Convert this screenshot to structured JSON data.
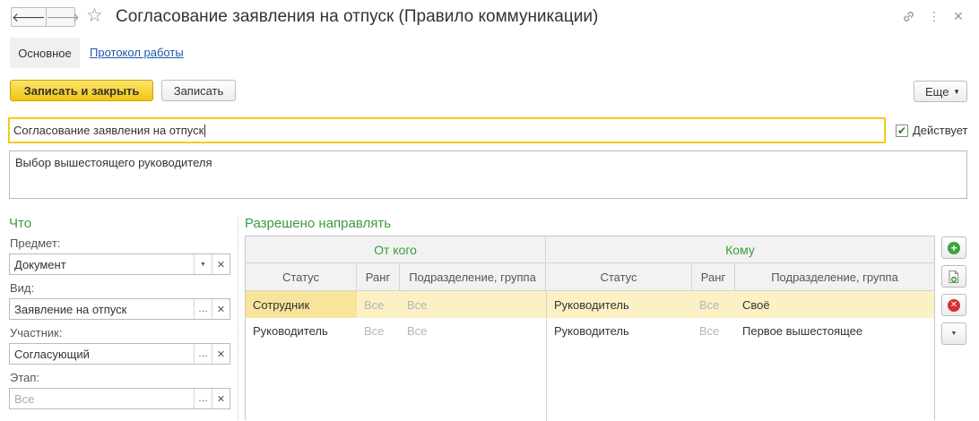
{
  "window": {
    "title": "Согласование заявления на отпуск (Правило коммуникации)"
  },
  "icons": {
    "back": "arrow-left-icon",
    "forward": "arrow-right-icon",
    "favorite": "star-icon",
    "link": "link-icon",
    "more": "vertical-dots-icon",
    "close": "close-icon"
  },
  "tabs": {
    "main": "Основное",
    "log": "Протокол работы"
  },
  "toolbar": {
    "save_close": "Записать и закрыть",
    "save": "Записать",
    "more": "Еще"
  },
  "form": {
    "name_value": "Согласование заявления на отпуск",
    "active_label": "Действует",
    "active_checked": true,
    "description": "Выбор вышестоящего руководителя"
  },
  "what": {
    "title": "Что",
    "subject_label": "Предмет:",
    "subject_value": "Документ",
    "kind_label": "Вид:",
    "kind_value": "Заявление на отпуск",
    "participant_label": "Участник:",
    "participant_value": "Согласующий",
    "stage_label": "Этап:",
    "stage_placeholder": "Все"
  },
  "allowed": {
    "title": "Разрешено направлять",
    "group_from": "От кого",
    "group_to": "Кому",
    "columns": [
      "Статус",
      "Ранг",
      "Подразделение, группа",
      "Статус",
      "Ранг",
      "Подразделение, группа"
    ],
    "rows": [
      [
        "Сотрудник",
        "Все",
        "Все",
        "Руководитель",
        "Все",
        "Своё"
      ],
      [
        "Руководитель",
        "Все",
        "Все",
        "Руководитель",
        "Все",
        "Первое вышестоящее"
      ]
    ]
  },
  "colors": {
    "accent_green": "#3f9a3f",
    "primary_button": "#f0c610",
    "selection": "#fbf1c4",
    "link": "#1c5aa8"
  }
}
